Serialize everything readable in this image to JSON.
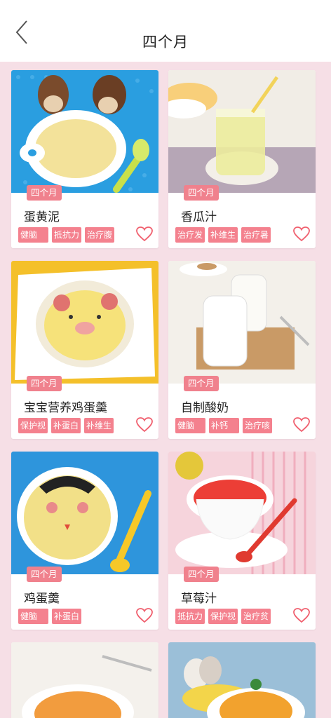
{
  "header": {
    "title": "四个月"
  },
  "cards": [
    {
      "badge": "四个月",
      "title": "蛋黄泥",
      "tags": [
        "健脑",
        "抵抗力",
        "治疗腹"
      ]
    },
    {
      "badge": "四个月",
      "title": "香瓜汁",
      "tags": [
        "治疗发",
        "补维生",
        "治疗暑"
      ]
    },
    {
      "badge": "四个月",
      "title": "宝宝营养鸡蛋羹",
      "tags": [
        "保护视",
        "补蛋白",
        "补维生"
      ]
    },
    {
      "badge": "四个月",
      "title": "自制酸奶",
      "tags": [
        "健脑",
        "补钙",
        "治疗咳"
      ]
    },
    {
      "badge": "四个月",
      "title": "鸡蛋羹",
      "tags": [
        "健脑",
        "补蛋白"
      ]
    },
    {
      "badge": "四个月",
      "title": "草莓汁",
      "tags": [
        "抵抗力",
        "保护视",
        "治疗贫"
      ]
    }
  ],
  "colors": {
    "accent": "#f0818d",
    "background": "#f6dfe6"
  }
}
